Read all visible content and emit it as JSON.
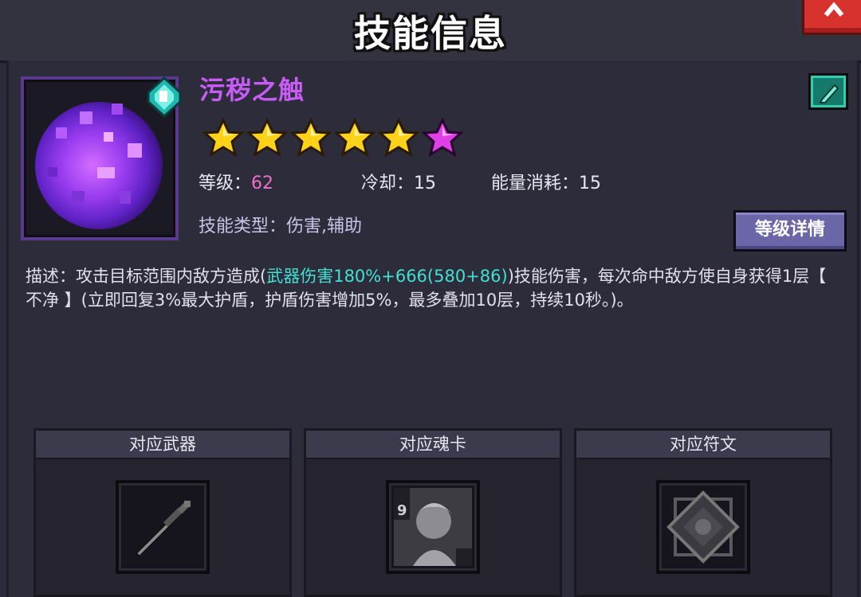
{
  "window": {
    "title": "技能信息"
  },
  "skill": {
    "name": "污秽之触",
    "stars_gold": 5,
    "stars_pink": 1,
    "level_label": "等级：",
    "level_value": "62",
    "cooldown_label": "冷却：",
    "cooldown_value": "15",
    "energy_label": "能量消耗：",
    "energy_value": "15",
    "type_label": "技能类型：",
    "type_value": "伤害,辅助",
    "detail_button": "等级详情"
  },
  "description": {
    "prefix": "描述：攻击目标范围内敌方造成(",
    "highlight": "武器伤害180%+666(580+86)",
    "suffix": ")技能伤害，每次命中敌方使自身获得1层【 不净 】(立即回复3%最大护盾，护盾伤害增加5%，最多叠加10层，持续10秒。)。"
  },
  "slots": [
    {
      "title": "对应武器",
      "icon": "sword-icon"
    },
    {
      "title": "对应魂卡",
      "icon": "soul-card-icon",
      "card_level": "9"
    },
    {
      "title": "对应符文",
      "icon": "rune-icon"
    }
  ],
  "colors": {
    "skill_name": "#c85cf5",
    "value_pink": "#f06fc8",
    "highlight_cyan": "#41e0d2",
    "close_red": "#d8322f",
    "button_purple": "#6a66a8"
  }
}
